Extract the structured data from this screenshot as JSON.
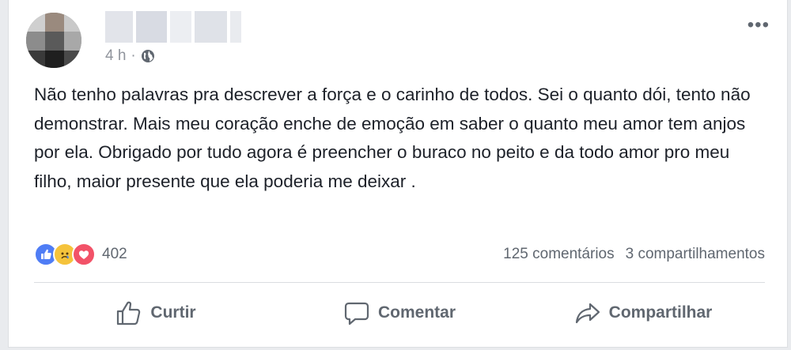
{
  "post": {
    "timestamp": "4 h",
    "separator": "·",
    "privacy_icon": "globe-icon",
    "more_label": "•••",
    "text": "Não tenho palavras pra descrever a força e o carinho de todos. Sei o quanto dói, tento não demonstrar. Mais meu coração enche de emoção em saber o quanto meu amor tem anjos por ela. Obrigado por tudo agora é preencher o buraco no peito e da todo amor pro meu filho, maior presente que ela poderia me deixar ."
  },
  "reactions": {
    "icons": [
      "like-icon",
      "sad-icon",
      "love-icon"
    ],
    "count": "402",
    "colors": {
      "like": "#4f7df5",
      "sad": "#f5c33b",
      "love": "#f25268"
    }
  },
  "stats": {
    "comments": "125 comentários",
    "shares": "3 compartilhamentos"
  },
  "actions": {
    "like_label": "Curtir",
    "comment_label": "Comentar",
    "share_label": "Compartilhar"
  }
}
